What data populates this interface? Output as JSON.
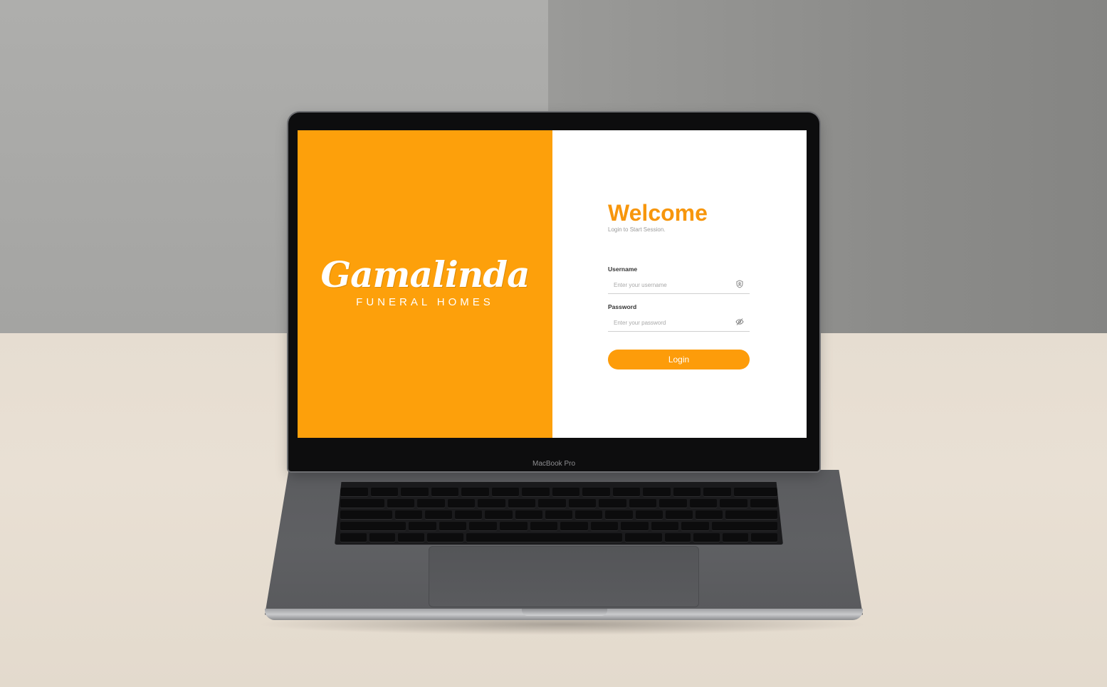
{
  "brand": {
    "logo_script": "Gamalinda",
    "logo_subtitle": "FUNERAL HOMES"
  },
  "login": {
    "title": "Welcome",
    "subtitle": "Login to Start Session.",
    "username": {
      "label": "Username",
      "placeholder": "Enter your username",
      "icon": "shield-user-icon"
    },
    "password": {
      "label": "Password",
      "placeholder": "Enter your password",
      "icon": "eye-off-icon"
    },
    "submit_label": "Login"
  },
  "device": {
    "model_label": "MacBook Pro"
  },
  "colors": {
    "brand_orange": "#fda00b",
    "title_orange": "#f7960c",
    "panel_white": "#ffffff"
  }
}
